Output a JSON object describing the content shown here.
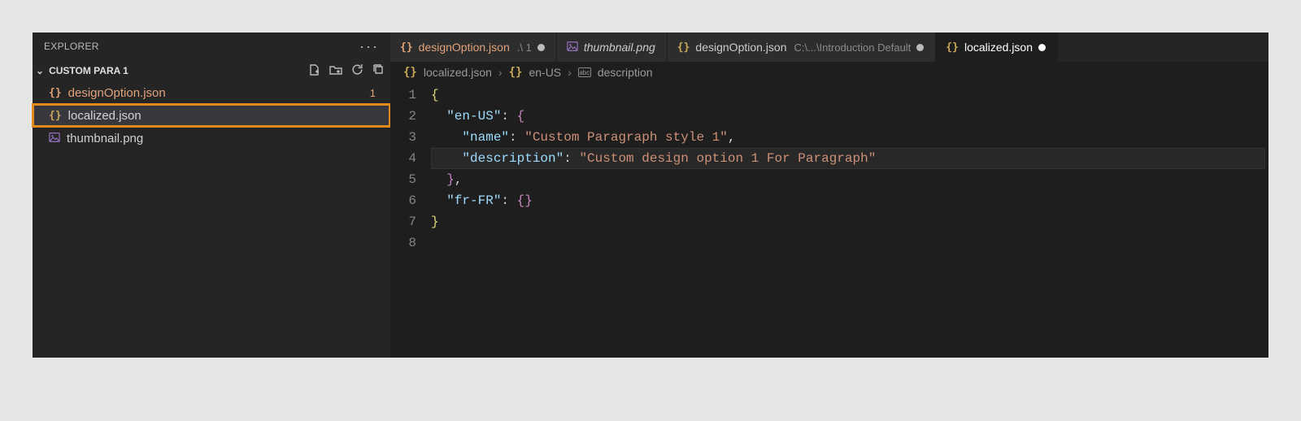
{
  "explorer": {
    "title": "EXPLORER",
    "section": "CUSTOM PARA 1",
    "files": [
      {
        "name": "designOption.json",
        "badge": "1"
      },
      {
        "name": "localized.json"
      },
      {
        "name": "thumbnail.png"
      }
    ]
  },
  "tabs": [
    {
      "icon": "{}",
      "title": "designOption.json",
      "sub": ".\\ 1",
      "modified": true,
      "dirty": true
    },
    {
      "icon": "img",
      "title": "thumbnail.png",
      "italic": true
    },
    {
      "icon": "{}",
      "title": "designOption.json",
      "sub": "C:\\...\\Introduction Default",
      "dirty": true
    },
    {
      "icon": "{}",
      "title": "localized.json",
      "active": true,
      "dirty": true
    }
  ],
  "breadcrumb": {
    "file": "localized.json",
    "seg1": "en-US",
    "seg2": "description"
  },
  "code": {
    "lines": [
      "1",
      "2",
      "3",
      "4",
      "5",
      "6",
      "7",
      "8"
    ],
    "l1": "{",
    "l2_key": "\"en-US\"",
    "l3_key": "\"name\"",
    "l3_val": "\"Custom Paragraph style 1\"",
    "l4_key": "\"description\"",
    "l4_val": "\"Custom design option 1 For Paragraph\"",
    "l6_key": "\"fr-FR\"",
    "punct_colon": ": ",
    "punct_comma": ",",
    "brace_open": "{",
    "brace_close": "}",
    "empty_obj": "{}"
  }
}
